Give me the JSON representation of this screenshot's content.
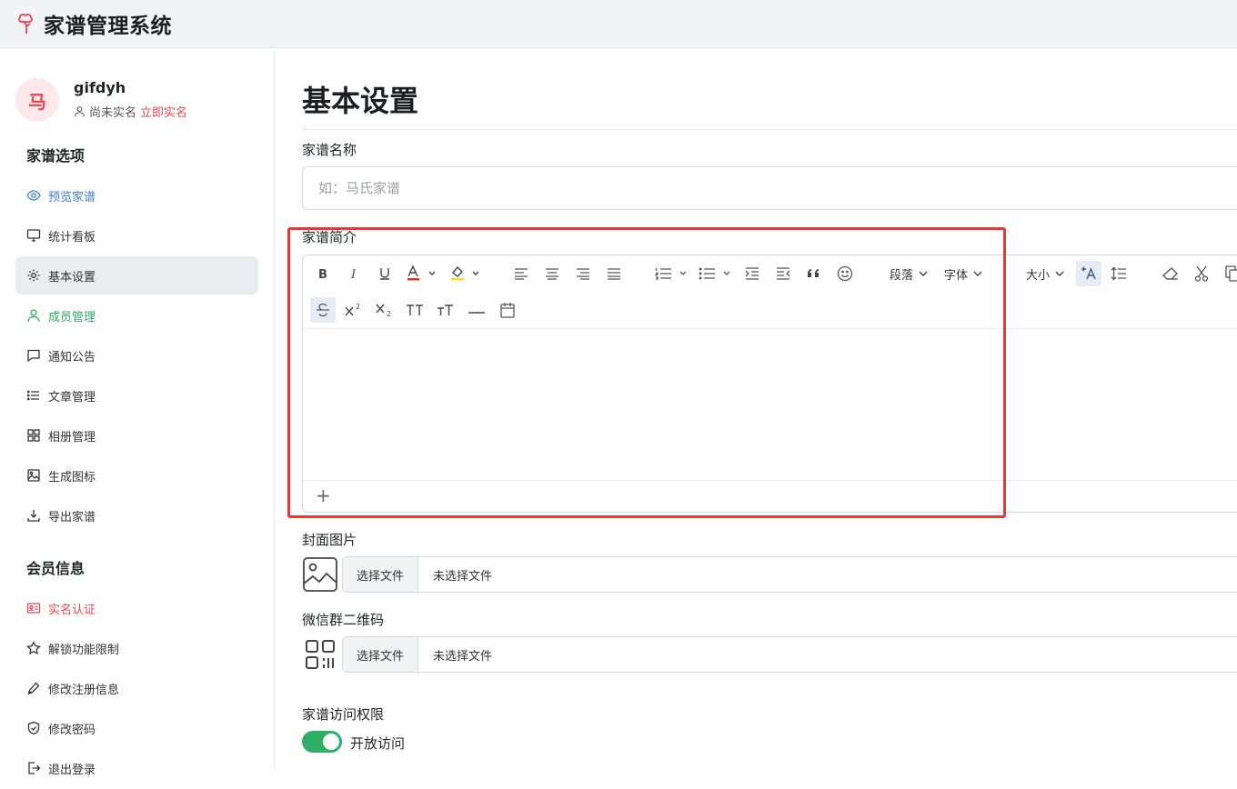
{
  "app": {
    "title": "家谱管理系统",
    "accent": "#e8474f"
  },
  "user": {
    "avatar_char": "马",
    "name": "gifdyh",
    "status": "尚未实名",
    "verify_link": "立即实名"
  },
  "sidebar": {
    "section1_title": "家谱选项",
    "items1": [
      {
        "label": "预览家谱",
        "icon": "eye-icon"
      },
      {
        "label": "统计看板",
        "icon": "monitor-icon"
      },
      {
        "label": "基本设置",
        "icon": "gear-icon"
      },
      {
        "label": "成员管理",
        "icon": "person-icon"
      },
      {
        "label": "通知公告",
        "icon": "chat-icon"
      },
      {
        "label": "文章管理",
        "icon": "list-icon"
      },
      {
        "label": "相册管理",
        "icon": "grid-icon"
      },
      {
        "label": "生成图标",
        "icon": "image-icon"
      },
      {
        "label": "导出家谱",
        "icon": "download-icon"
      }
    ],
    "section2_title": "会员信息",
    "items2": [
      {
        "label": "实名认证",
        "icon": "id-card-icon"
      },
      {
        "label": "解锁功能限制",
        "icon": "star-icon"
      },
      {
        "label": "修改注册信息",
        "icon": "pen-icon"
      },
      {
        "label": "修改密码",
        "icon": "shield-icon"
      },
      {
        "label": "退出登录",
        "icon": "logout-icon"
      }
    ]
  },
  "main": {
    "page_title": "基本设置",
    "name_label": "家谱名称",
    "name_placeholder": "如：马氏家谱",
    "intro_label": "家谱简介",
    "editor": {
      "paragraph_label": "段落",
      "font_label": "字体",
      "size_label": "大小",
      "plus_label": "+"
    },
    "cover_label": "封面图片",
    "cover_button": "选择文件",
    "cover_status": "未选择文件",
    "qr_label": "微信群二维码",
    "qr_button": "选择文件",
    "qr_status": "未选择文件",
    "access_label": "家谱访问权限",
    "access_toggle_label": "开放访问",
    "access_on": true
  }
}
